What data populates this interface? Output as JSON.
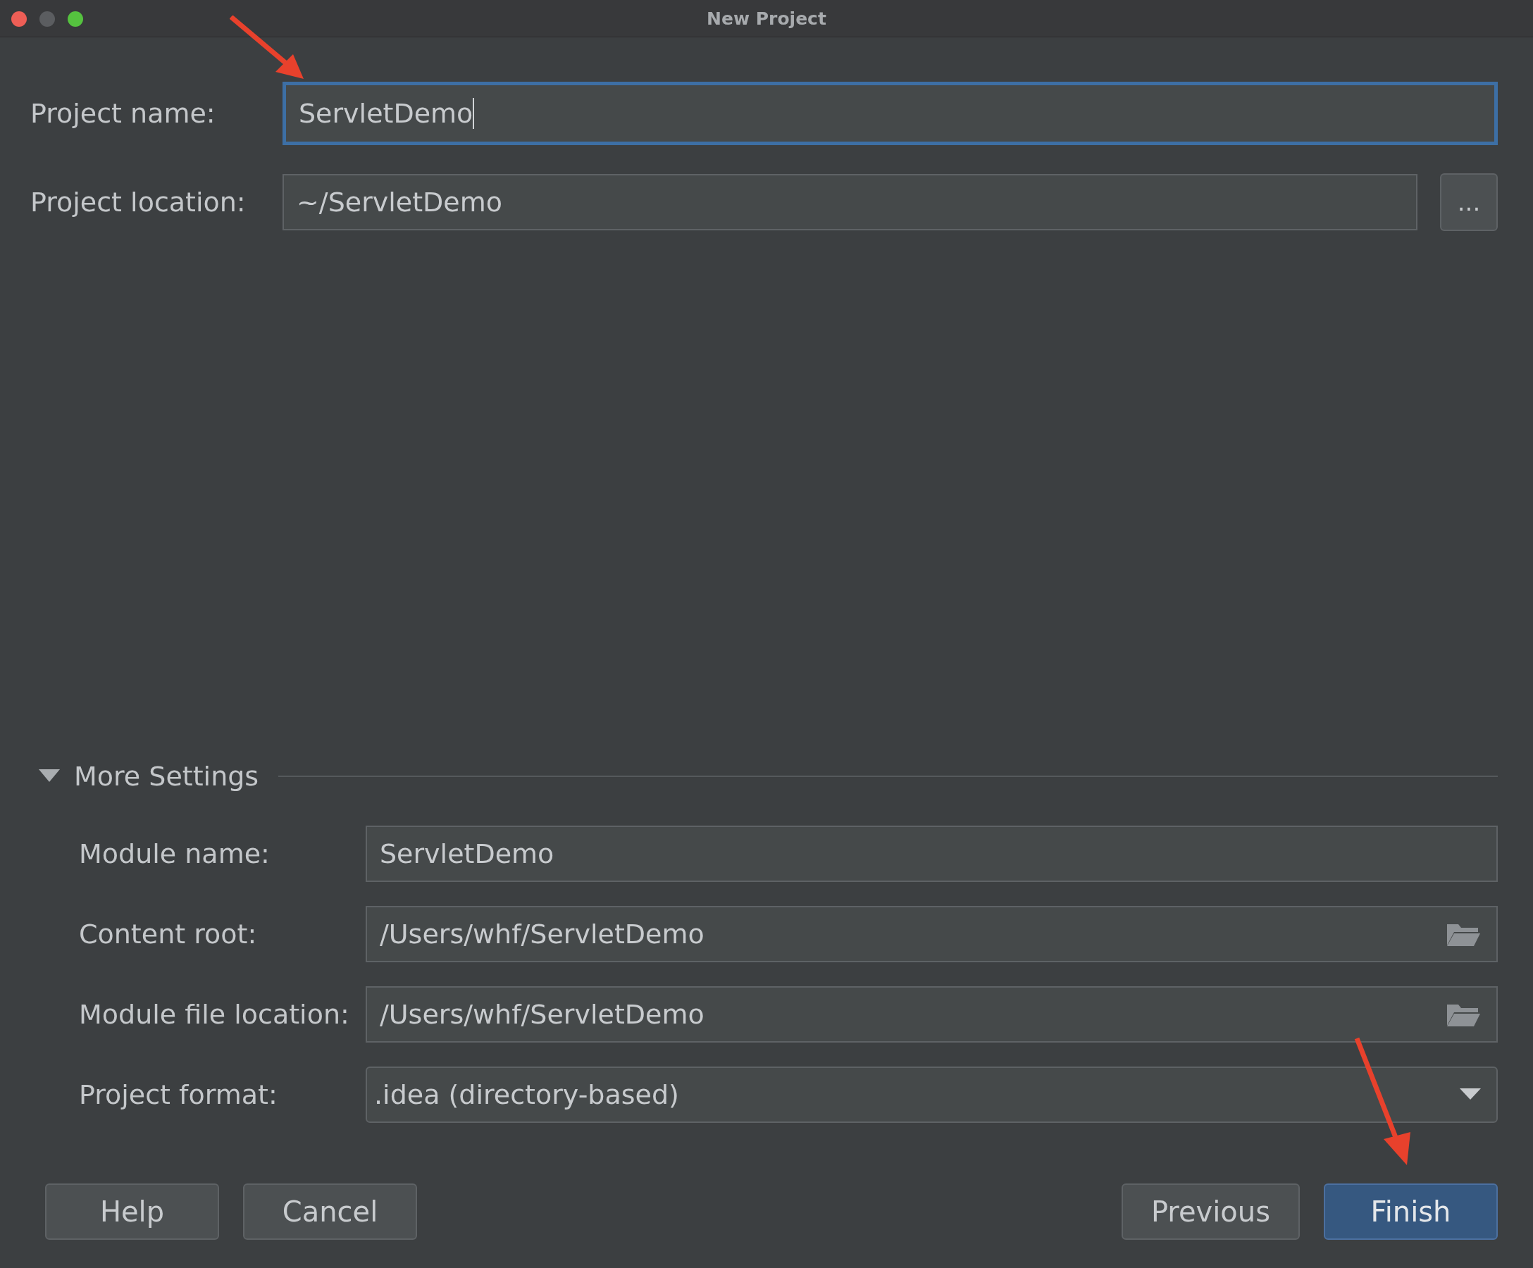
{
  "window": {
    "title": "New Project"
  },
  "project_fields": [
    {
      "label": "Project name:",
      "value": "ServletDemo",
      "focused": true,
      "kind": "text"
    },
    {
      "label": "Project location:",
      "value": "~/ServletDemo",
      "focused": false,
      "kind": "browse",
      "button": "..."
    }
  ],
  "more_settings": {
    "label": "More Settings",
    "expanded": true
  },
  "module_fields": [
    {
      "label": "Module name:",
      "value": "ServletDemo",
      "kind": "text"
    },
    {
      "label": "Content root:",
      "value": "/Users/whf/ServletDemo",
      "kind": "folder"
    },
    {
      "label": "Module file location:",
      "value": "/Users/whf/ServletDemo",
      "kind": "folder"
    },
    {
      "label": "Project format:",
      "value": ".idea (directory-based)",
      "kind": "dropdown"
    }
  ],
  "buttons_left": [
    {
      "label": "Help",
      "primary": false
    },
    {
      "label": "Cancel",
      "primary": false
    }
  ],
  "buttons_right": [
    {
      "label": "Previous",
      "primary": false
    },
    {
      "label": "Finish",
      "primary": true
    }
  ]
}
